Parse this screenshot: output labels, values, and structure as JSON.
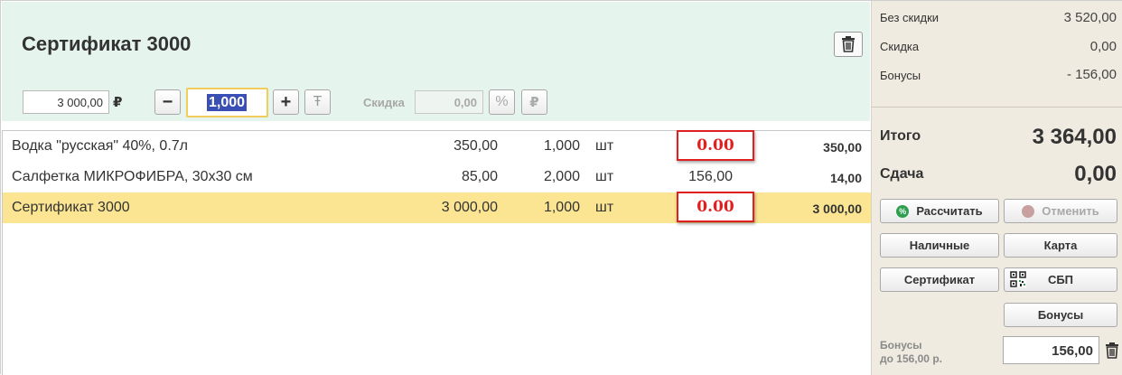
{
  "product": {
    "title": "Сертификат 3000",
    "price": "3 000,00",
    "currency": "₽",
    "quantity": "1,000",
    "discount_label": "Скидка",
    "discount_value": "0,00",
    "percent_symbol": "%",
    "ruble_symbol": "₽",
    "minus": "−",
    "plus": "+",
    "text_symbol": "Ŧ"
  },
  "items": [
    {
      "name": "Водка \"русская\" 40%, 0.7л",
      "price": "350,00",
      "qty": "1,000",
      "unit": "шт",
      "discount": "0.00",
      "sum": "350,00",
      "highlighted": true,
      "selected": false
    },
    {
      "name": "Салфетка МИКРОФИБРА, 30х30 см",
      "price": "85,00",
      "qty": "2,000",
      "unit": "шт",
      "discount": "156,00",
      "sum": "14,00",
      "highlighted": false,
      "selected": false
    },
    {
      "name": "Сертификат 3000",
      "price": "3 000,00",
      "qty": "1,000",
      "unit": "шт",
      "discount": "0.00",
      "sum": "3 000,00",
      "highlighted": true,
      "selected": true
    }
  ],
  "summary": {
    "no_discount_label": "Без скидки",
    "no_discount_value": "3 520,00",
    "discount_label": "Скидка",
    "discount_value": "0,00",
    "bonus_label": "Бонусы",
    "bonus_value": "- 156,00",
    "total_label": "Итого",
    "total_value": "3 364,00",
    "change_label": "Сдача",
    "change_value": "0,00"
  },
  "buttons": {
    "calculate": "Рассчитать",
    "cancel": "Отменить",
    "cash": "Наличные",
    "card": "Карта",
    "certificate": "Сертификат",
    "sbp": "СБП",
    "bonuses": "Бонусы"
  },
  "bonus_panel": {
    "line1": "Бонусы",
    "line2": "до 156,00 р.",
    "value": "156,00"
  },
  "colors": {
    "header_bg": "#e6f4ee",
    "selected_row": "#fbe592",
    "discount_highlight": "#e02020",
    "right_panel_bg": "#efebe0",
    "calculate_icon": "#2e9e4f",
    "cancel_icon": "#c8a0a0"
  }
}
